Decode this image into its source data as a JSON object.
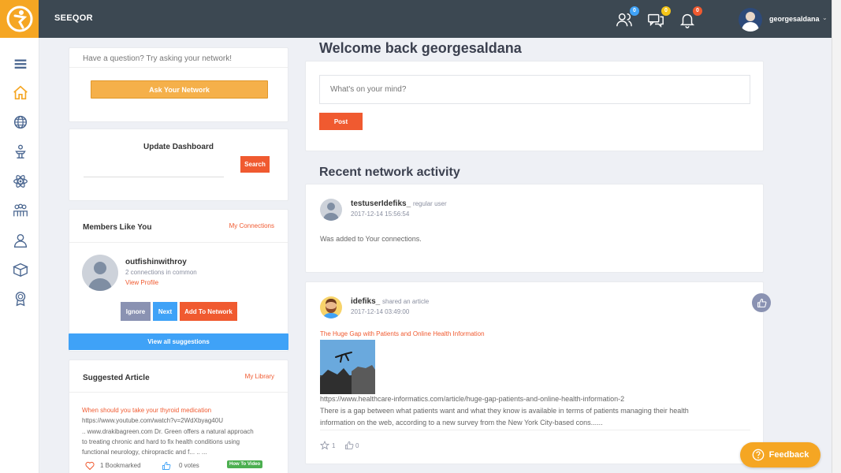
{
  "app": {
    "brand": "SEEQOR"
  },
  "header": {
    "username": "georgesaldana",
    "badges": {
      "connections": "0",
      "messages": "0",
      "notifications": "0"
    },
    "colors": {
      "connections_badge": "#3fa2f7",
      "messages_badge": "#f5c518",
      "notifications_badge": "#f05a30"
    }
  },
  "sidebar": {
    "icons": [
      "menu-icon",
      "home-icon",
      "globe-icon",
      "podium-icon",
      "atom-icon",
      "group-icon",
      "user-badge-icon",
      "box-icon",
      "award-icon"
    ]
  },
  "ask": {
    "prompt": "Have a question? Try asking your network!",
    "button": "Ask Your Network"
  },
  "dashboard": {
    "title": "Update Dashboard",
    "search_button": "Search"
  },
  "members": {
    "title": "Members Like You",
    "link": "My Connections",
    "member": {
      "name": "outfishinwithroy",
      "common": "2 connections in common",
      "view_profile": "View Profile"
    },
    "ignore": "Ignore",
    "next": "Next",
    "add": "Add To Network",
    "view_all": "View all suggestions"
  },
  "suggested": {
    "title": "Suggested Article",
    "link": "My Library",
    "article_title": "When should you take your thyroid medication",
    "url": "https://www.youtube.com/watch?v=2WdXbyag40U",
    "desc_line1": ".. www.drakibagreen.com Dr. Green offers a natural approach",
    "desc_line2": "to treating chronic and hard to fix health conditions using",
    "desc_line3": "functional neurology, chiropractic and f... .. ...",
    "bookmarks": "1 Bookmarked",
    "votes": "0 votes",
    "tag": "How To Video"
  },
  "welcome": {
    "title": "Welcome back georgesaldana",
    "post_placeholder": "What's on your mind?",
    "post_button": "Post"
  },
  "activity": {
    "title": "Recent network activity",
    "item1": {
      "user": "testuserIdefiks_",
      "role": "regular user",
      "time": "2017-12-14 15:56:54",
      "text": "Was added to Your connections."
    },
    "item2": {
      "user": "idefiks_",
      "action": "shared an article",
      "time": "2017-12-14 03:49:00",
      "article_title": "The Huge Gap with Patients and Online Health Information",
      "url": "https://www.healthcare-informatics.com/article/huge-gap-patients-and-online-health-information-2",
      "desc_line1": "There is a gap between what patients want and what they know is available in terms of patients managing their health",
      "desc_line2": "information on the web, according to a new survey from the New York City-based cons......",
      "stars": "1",
      "likes": "0"
    }
  },
  "feedback": {
    "label": "Feedback"
  }
}
